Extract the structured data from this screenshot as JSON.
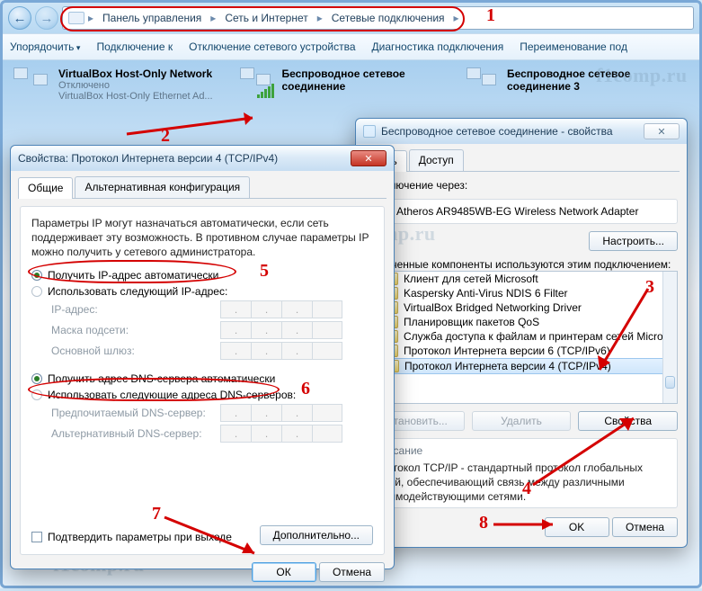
{
  "nav": {
    "crumbs": [
      "Панель управления",
      "Сеть и Интернет",
      "Сетевые подключения"
    ]
  },
  "toolbar": {
    "organize": "Упорядочить",
    "connect": "Подключение к",
    "disable": "Отключение сетевого устройства",
    "diag": "Диагностика подключения",
    "rename": "Переименование под"
  },
  "connections": [
    {
      "name": "VirtualBox Host-Only Network",
      "status": "Отключено",
      "driver": "VirtualBox Host-Only Ethernet Ad..."
    },
    {
      "name": "Беспроводное сетевое соединение",
      "status": "",
      "driver": ""
    },
    {
      "name": "Беспроводное сетевое соединение 3",
      "status": "",
      "driver": ""
    }
  ],
  "ipv4": {
    "title": "Свойства: Протокол Интернета версии 4 (TCP/IPv4)",
    "tabs": {
      "general": "Общие",
      "alt": "Альтернативная конфигурация"
    },
    "para": "Параметры IP могут назначаться автоматически, если сеть поддерживает эту возможность. В противном случае параметры IP можно получить у сетевого администратора.",
    "r1": "Получить IP-адрес автоматически",
    "r2": "Использовать следующий IP-адрес:",
    "f_ip": "IP-адрес:",
    "f_mask": "Маска подсети:",
    "f_gw": "Основной шлюз:",
    "r3": "Получить адрес DNS-сервера автоматически",
    "r4": "Использовать следующие адреса DNS-серверов:",
    "f_dns1": "Предпочитаемый DNS-сервер:",
    "f_dns2": "Альтернативный DNS-сервер:",
    "chk": "Подтвердить параметры при выходе",
    "adv": "Дополнительно...",
    "ok": "ОК",
    "cancel": "Отмена"
  },
  "props": {
    "title": "Беспроводное сетевое соединение - свойства",
    "tabs": {
      "net": "Сеть",
      "access": "Доступ"
    },
    "via_label": "Подключение через:",
    "adapter": "Atheros AR9485WB-EG Wireless Network Adapter",
    "configure": "Настроить...",
    "comp_label": "Отмеченные компоненты используются этим подключением:",
    "components": [
      "Клиент для сетей Microsoft",
      "Kaspersky Anti-Virus NDIS 6 Filter",
      "VirtualBox Bridged Networking Driver",
      "Планировщик пакетов QoS",
      "Служба доступа к файлам и принтерам сетей Micro",
      "Протокол Интернета версии 6 (TCP/IPv6)",
      "Протокол Интернета версии 4 (TCP/IPv4)"
    ],
    "install": "Установить...",
    "remove": "Удалить",
    "props": "Свойства",
    "desc_h": "Описание",
    "desc": "Протокол TCP/IP - стандартный протокол глобальных сетей, обеспечивающий связь между различными взаимодействующими сетями.",
    "ok": "OK",
    "cancel": "Отмена"
  },
  "annot": {
    "1": "1",
    "2": "2",
    "3": "3",
    "4": "4",
    "5": "5",
    "6": "6",
    "7": "7",
    "8": "8"
  },
  "watermark": "f1comp.ru"
}
